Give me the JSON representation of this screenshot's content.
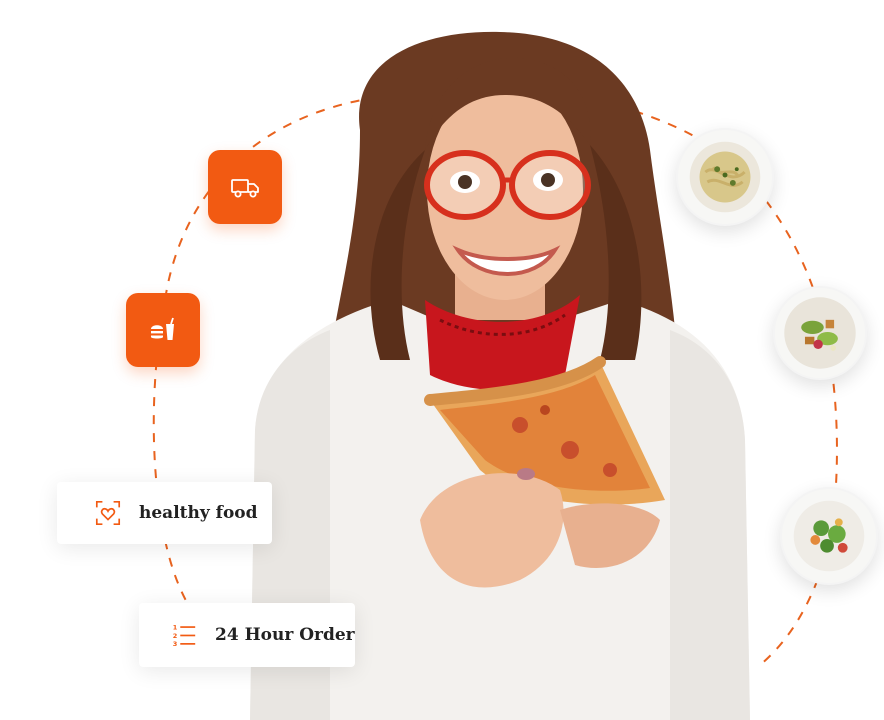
{
  "features": {
    "healthy_food": "healthy food",
    "hour_order": "24 Hour Order"
  },
  "icons": {
    "truck": "delivery-truck-icon",
    "burger": "burger-drink-icon",
    "heart": "heart-scan-icon",
    "list": "numbered-list-icon"
  },
  "colors": {
    "accent": "#f25a12",
    "card_bg": "#ffffff",
    "text": "#222222"
  }
}
